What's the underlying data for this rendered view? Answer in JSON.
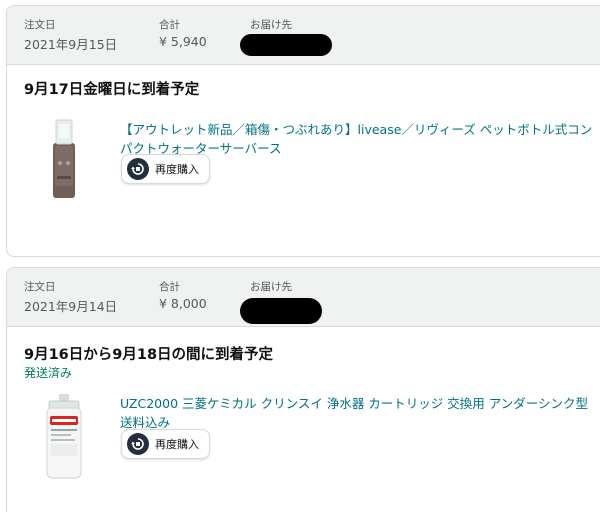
{
  "orders": [
    {
      "date_label": "注文日",
      "date": "2021年9月15日",
      "total_label": "合計",
      "total": "¥ 5,940",
      "ship_to_label": "お届け先",
      "delivery": "9月17日金曜日に到着予定",
      "status": "",
      "product_title": "【アウトレット新品／箱傷・つぶれあり】livease／リヴィーズ ペットボトル式コンパクトウォーターサーバース",
      "buy_again_label": "再度購入"
    },
    {
      "date_label": "注文日",
      "date": "2021年9月14日",
      "total_label": "合計",
      "total": "¥ 8,000",
      "ship_to_label": "お届け先",
      "delivery": "9月16日から9月18日の間に到着予定",
      "status": "発送済み",
      "product_title": "UZC2000 三菱ケミカル クリンスイ 浄水器 カートリッジ 交換用 アンダーシンク型 送料込み",
      "buy_again_label": "再度購入"
    }
  ],
  "colors": {
    "link": "#007185",
    "shipped": "#067d62",
    "header_bg": "#f0f2f2",
    "border": "#d5d9d9"
  },
  "icons": {
    "buy_again": "reorder-icon"
  }
}
